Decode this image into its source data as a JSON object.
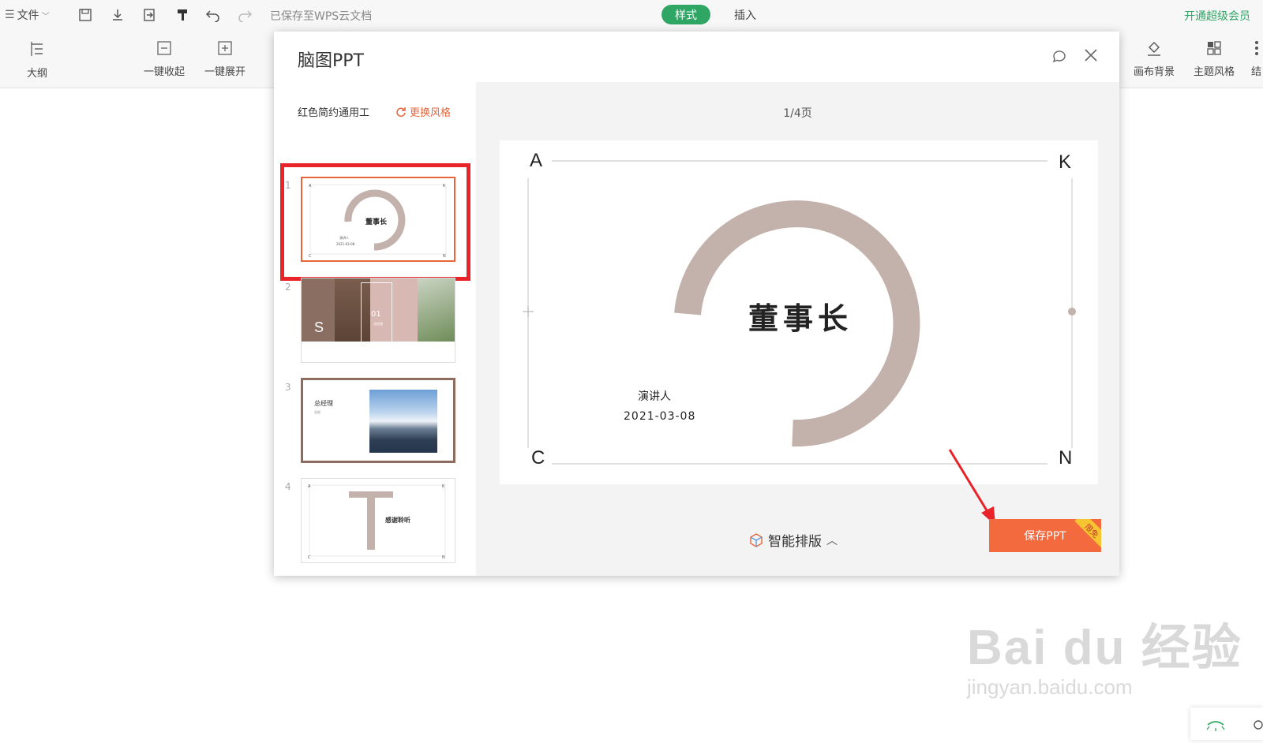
{
  "toolbar": {
    "file_menu": "文件",
    "save_status": "已保存至WPS云文档",
    "tab_style": "样式",
    "tab_insert": "插入",
    "vip": "开通超级会员"
  },
  "ribbon": {
    "outline": "大纲",
    "collapse_all": "一键收起",
    "expand_all": "一键展开",
    "canvas_bg": "画布背景",
    "theme_style": "主题风格",
    "structure": "结"
  },
  "dialog": {
    "title": "脑图PPT",
    "template_name": "红色简约通用工",
    "change_style": "更换风格",
    "page_indicator": "1/4页",
    "smart_layout": "智能排版",
    "save_button": "保存PPT",
    "free_badge": "限免"
  },
  "thumbnails": [
    {
      "num": "1",
      "title": "董事长",
      "sub1": "演讲人",
      "sub2": "2021-03-08"
    },
    {
      "num": "2",
      "letter": "S",
      "num_label": "01",
      "sub": "总经理"
    },
    {
      "num": "3",
      "title": "总经理",
      "sub": "总经"
    },
    {
      "num": "4",
      "letter": "T",
      "title": "感谢聆听"
    }
  ],
  "slide": {
    "corner_a": "A",
    "corner_k": "K",
    "corner_c": "C",
    "corner_n": "N",
    "title": "董事长",
    "speaker": "演讲人",
    "date": "2021-03-08"
  },
  "watermark": {
    "main": "Bai du 经验",
    "sub": "jingyan.baidu.com"
  },
  "colors": {
    "accent_green": "#30a665",
    "accent_orange": "#f26a3d",
    "arc": "#c3b1ab",
    "highlight_red": "#e8232a"
  }
}
